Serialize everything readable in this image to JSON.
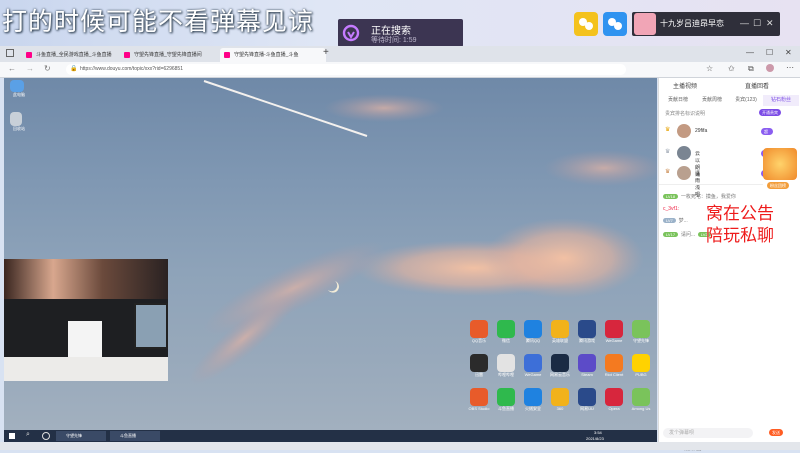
{
  "overlay": {
    "danmu_text": "打的时候可能不看弹幕见谅",
    "search_title": "正在搜索",
    "search_sub": "等待时间: 1:59",
    "user_name": "十九岁吕迪昂早恋",
    "window_controls": [
      "—",
      "☐",
      "✕"
    ]
  },
  "browser": {
    "tabs": [
      "斗鱼直播_全民游戏直播_斗鱼直播",
      "守望先锋直播_守望先锋直播间",
      "守望先锋直播-斗鱼直播_斗鱼"
    ],
    "new_tab": "+",
    "url": "https://www.douyu.com/topic/xxx?rid=6296851"
  },
  "stream": {
    "desktop_left_icons": [
      "此电脑",
      "回收站"
    ],
    "desktop_icons": [
      [
        "QQ音乐",
        "微信",
        "腾讯QQ",
        "英雄联盟",
        "腾讯游戏",
        "WeGame",
        "守望先锋"
      ],
      [
        "迅雷",
        "哔哩哔哩",
        "WeGame",
        "网易云音乐",
        "Steam",
        "Riot Client",
        "PUBG"
      ],
      [
        "OBS Studio",
        "斗鱼直播",
        "火绒安全",
        "360",
        "网易UU",
        "Opera",
        "Among Us"
      ]
    ],
    "taskbar_apps": [
      "守望先锋",
      "斗鱼直播"
    ],
    "taskbar_time": "3:54",
    "taskbar_date": "2021/8/23",
    "watermark": "激活 Windows"
  },
  "panel": {
    "top_tabs": [
      "主播视频",
      "直播回看"
    ],
    "sub_tabs": [
      "贡献日榜",
      "贡献周榜",
      "贵宾(123)",
      "钻石粉丝"
    ],
    "notice": "贵宾排名标识说明",
    "ranks": [
      {
        "name": "29fifa",
        "badge": "超级VIP"
      },
      {
        "name": "云以朗诵",
        "badge": "超级VIP"
      },
      {
        "name": "清雨浅唱",
        "badge": "超级VIP"
      }
    ],
    "chat": [
      {
        "lv": "LV18",
        "text": "一枚死宅：摸鱼，我爱你"
      },
      {
        "lv": "LV7",
        "text": "c_3vf1:"
      },
      {
        "lv": "LV17",
        "text": "梦..."
      },
      {
        "lv": "LV2",
        "text": "请问..."
      }
    ],
    "promo": "窝在公告\n陪玩私聊",
    "side_label": "粉丝团榜",
    "chat_placeholder": "发个弹幕呗",
    "send_btn": "发送"
  },
  "colors": {
    "accent": "#7c4ce6",
    "promo": "#ee1b1b",
    "yellow": "#f4c21d",
    "blue": "#2f93f0"
  }
}
